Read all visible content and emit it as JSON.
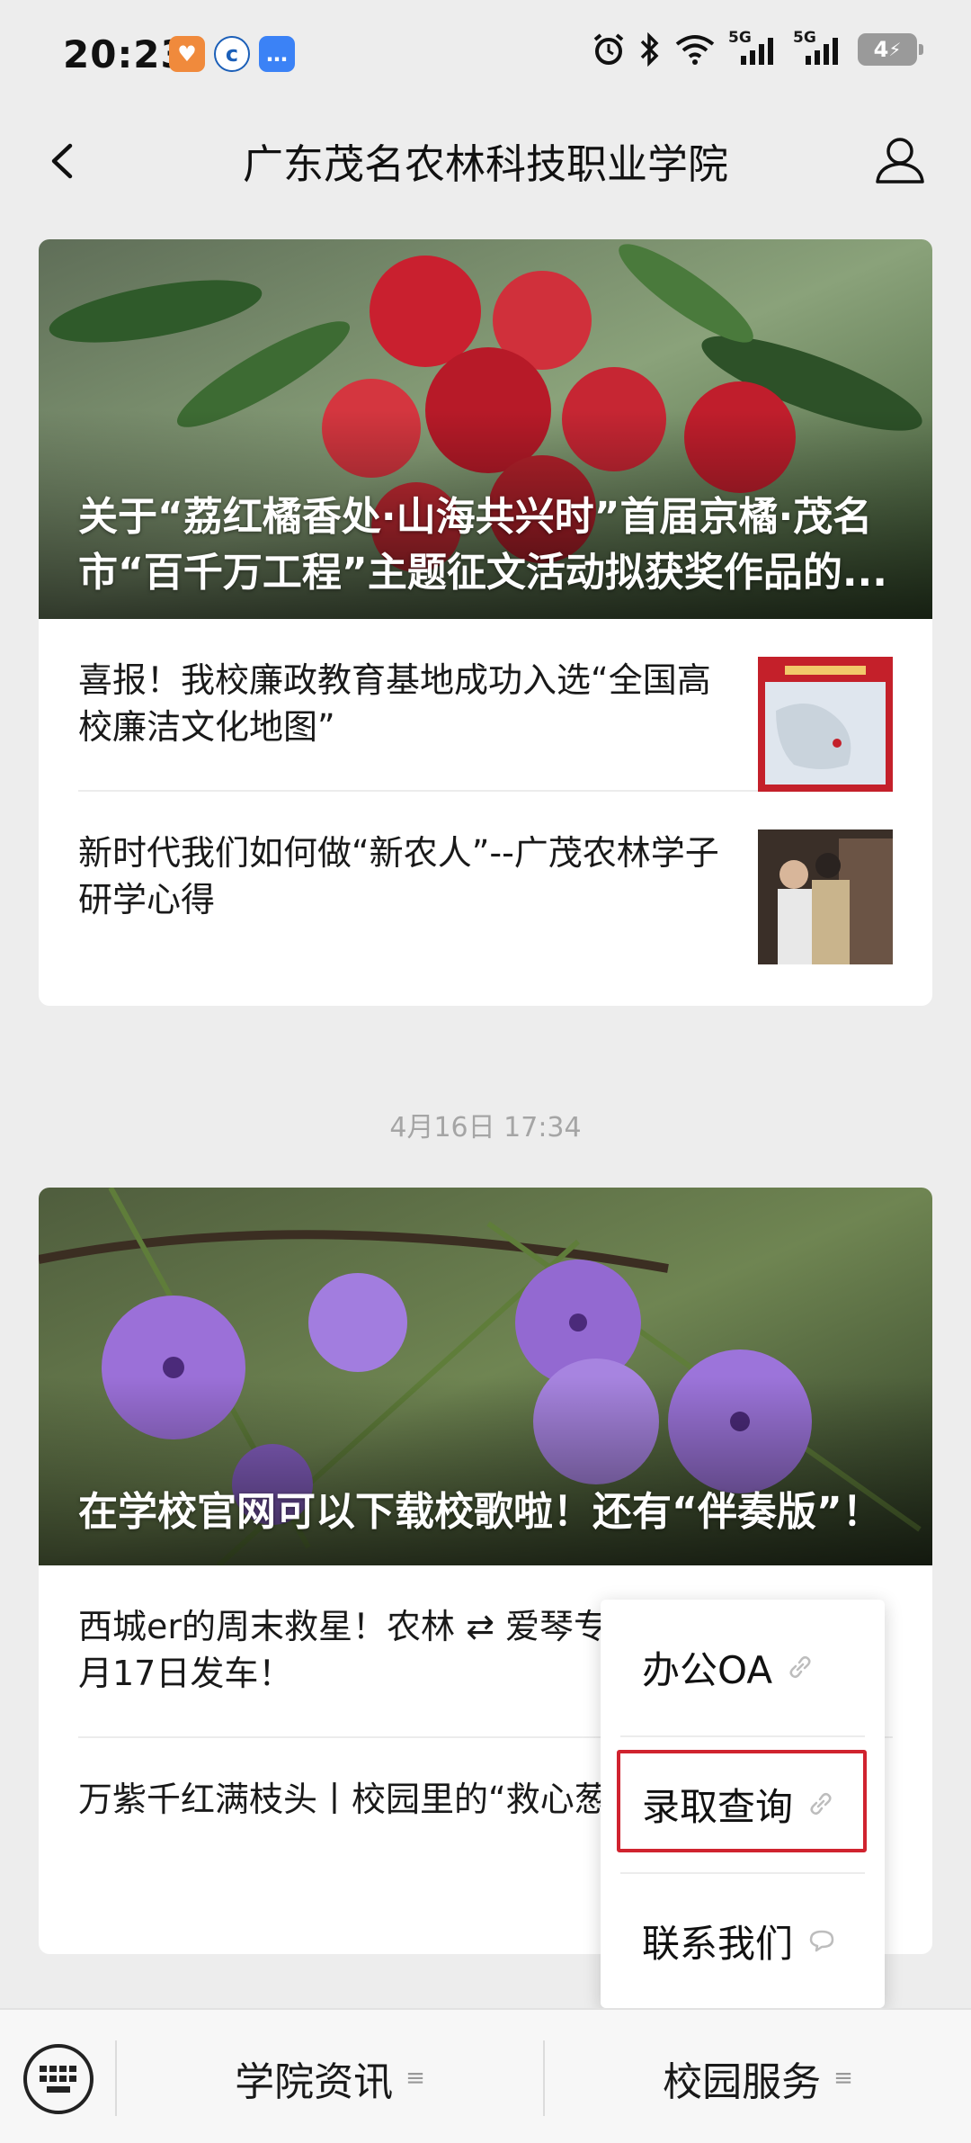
{
  "status_bar": {
    "time": "20:23",
    "battery": "4",
    "signal_1": "5G",
    "signal_2": "5G"
  },
  "nav": {
    "title": "广东茂名农林科技职业学院"
  },
  "card1": {
    "cover_title": "关于“荔红橘香处·山海共兴时”首届京橘·茂名市“百千万工程”主题征文活动拟获奖作品的...",
    "items": [
      {
        "title": "喜报！我校廉政教育基地成功入选“全国高校廉洁文化地图”"
      },
      {
        "title": "新时代我们如何做“新农人”--广茂农林学子研学心得"
      }
    ]
  },
  "timestamp": "4月16日 17:34",
  "card2": {
    "cover_title": "在学校官网可以下载校歌啦！还有“伴奏版”！",
    "items": [
      {
        "title": "西城er的周末救星！农林 ⇄ 爱琴专线，4月17日发车！"
      },
      {
        "title": "万紫千红满枝头丨校园里的“救心葱茏"
      }
    ]
  },
  "popup": {
    "items": [
      {
        "label": "办公OA",
        "icon": "link-icon"
      },
      {
        "label": "录取查询",
        "icon": "link-icon"
      },
      {
        "label": "联系我们",
        "icon": "chat-bubble-icon"
      }
    ]
  },
  "bottom_menu": {
    "menu_1": "学院资讯",
    "menu_2": "校园服务"
  },
  "colors": {
    "highlight_border": "#d0232f",
    "background": "#ededed"
  }
}
